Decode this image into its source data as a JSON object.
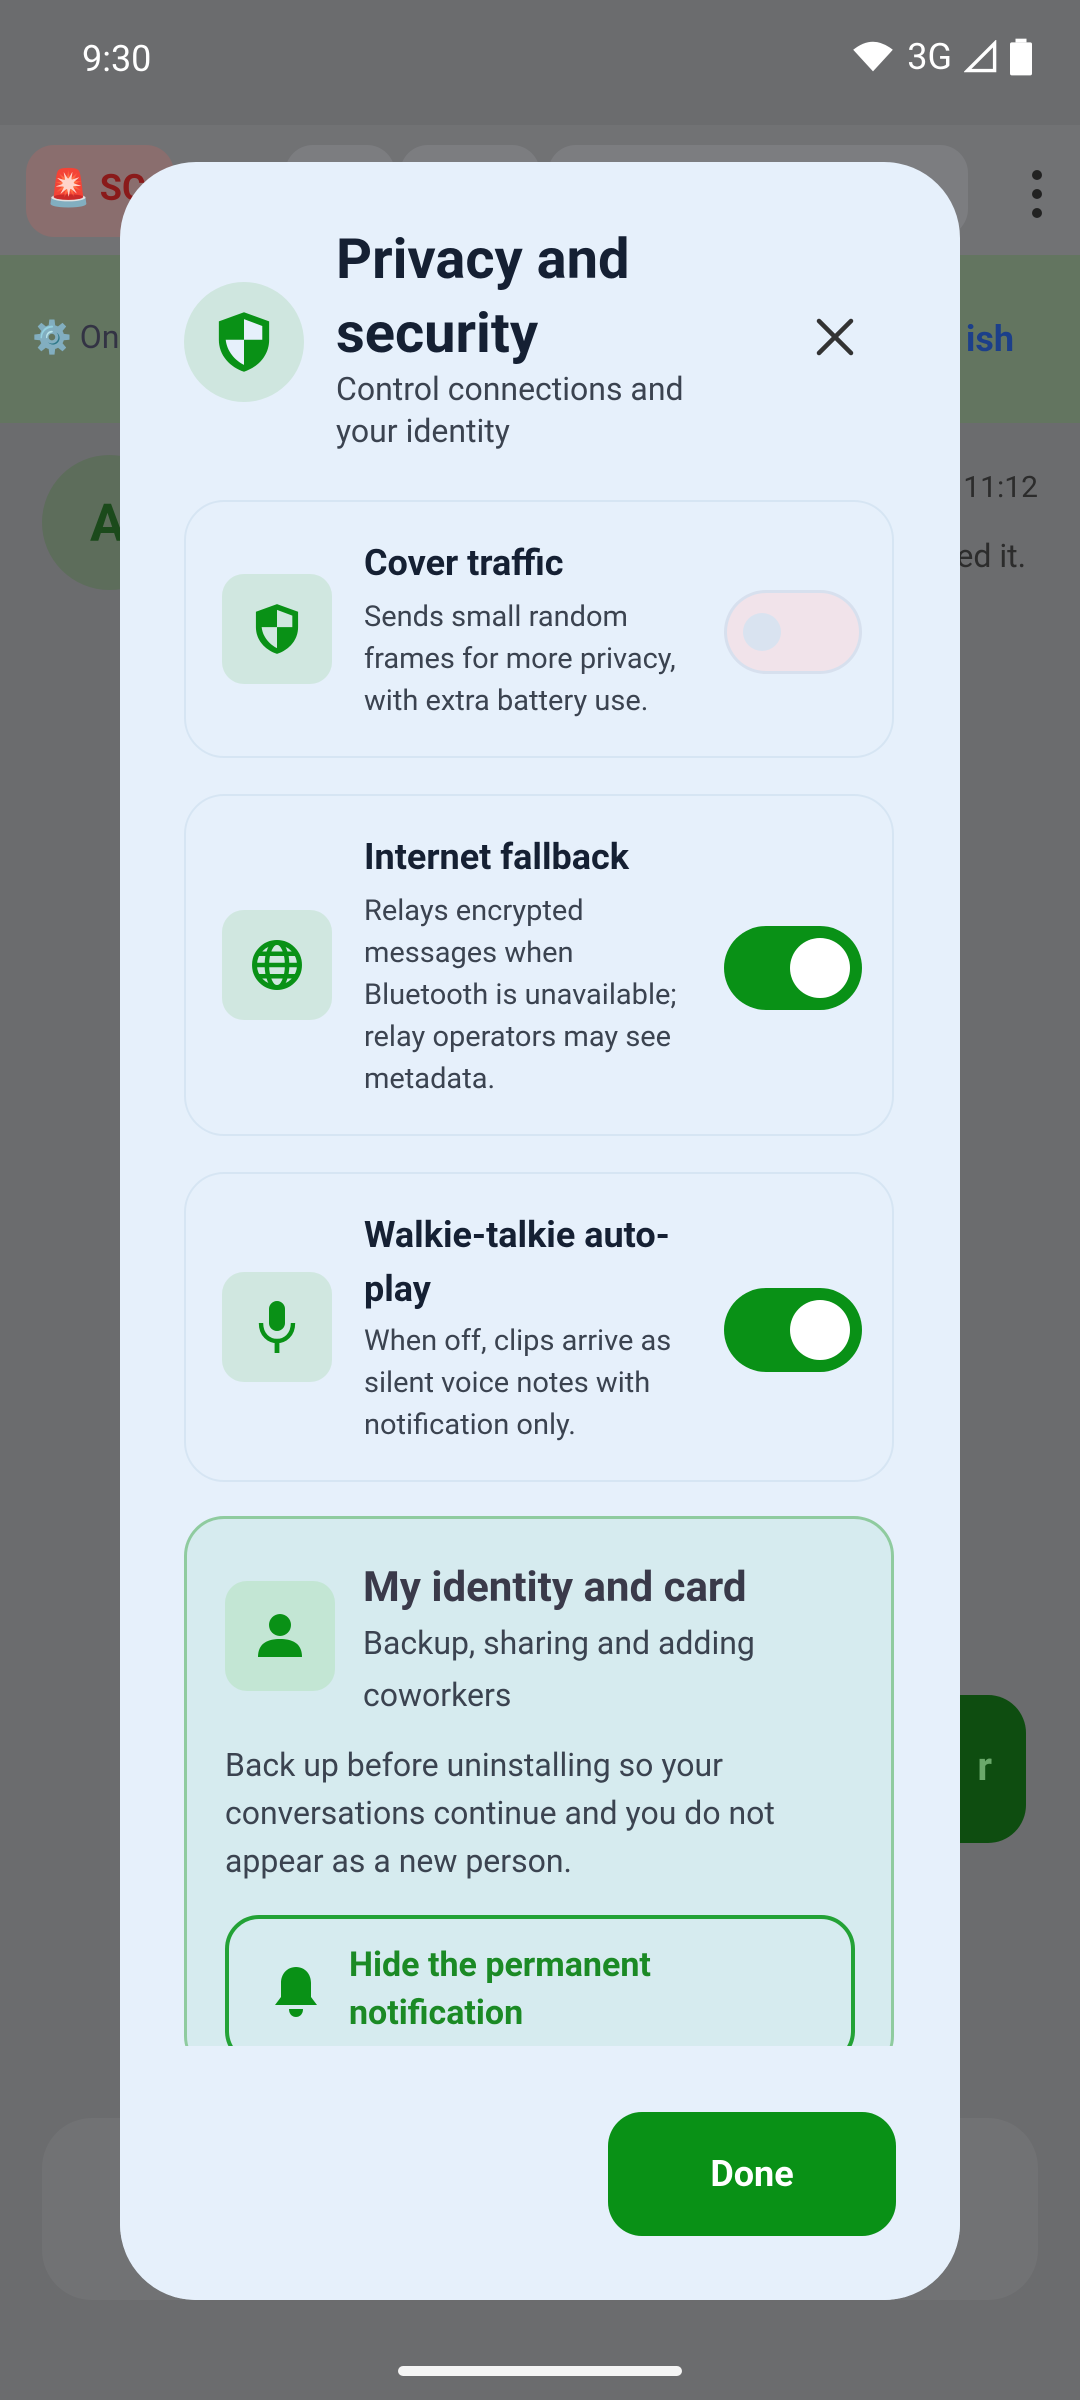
{
  "status_bar": {
    "time": "9:30",
    "network": "3G"
  },
  "background": {
    "sos_label": "SC",
    "banner_left": "⚙️ On",
    "banner_right": "ish",
    "avatar_initial": "A",
    "message_time": "11:12",
    "message_text": "ed it.",
    "fab_label": "r"
  },
  "dialog": {
    "title": "Privacy and security",
    "subtitle": "Control connections and your identity",
    "header_icon": "shield-icon",
    "close_icon": "close-icon",
    "settings": [
      {
        "title": "Cover traffic",
        "description": "Sends small random frames for more privacy, with extra battery use.",
        "icon": "shield-icon",
        "enabled": false
      },
      {
        "title": "Internet fallback",
        "description": "Relays encrypted messages when Bluetooth is unavailable; relay operators may see metadata.",
        "icon": "globe-icon",
        "enabled": true
      },
      {
        "title": "Walkie-talkie auto-play",
        "description": "When off, clips arrive as silent voice notes with notification only.",
        "icon": "microphone-icon",
        "enabled": true
      }
    ],
    "identity": {
      "title": "My identity and card",
      "subtitle": "Backup, sharing and adding coworkers",
      "body": "Back up before uninstalling so your conversations continue and you do not appear as a new person.",
      "icon": "person-icon",
      "hide_button": "Hide the permanent notification",
      "hide_icon": "bell-icon"
    },
    "done_label": "Done"
  },
  "colors": {
    "accent": "#099116",
    "dialog_bg": "#e6f0fb",
    "scrim": "#6b6c6e",
    "title_text": "#152033"
  }
}
